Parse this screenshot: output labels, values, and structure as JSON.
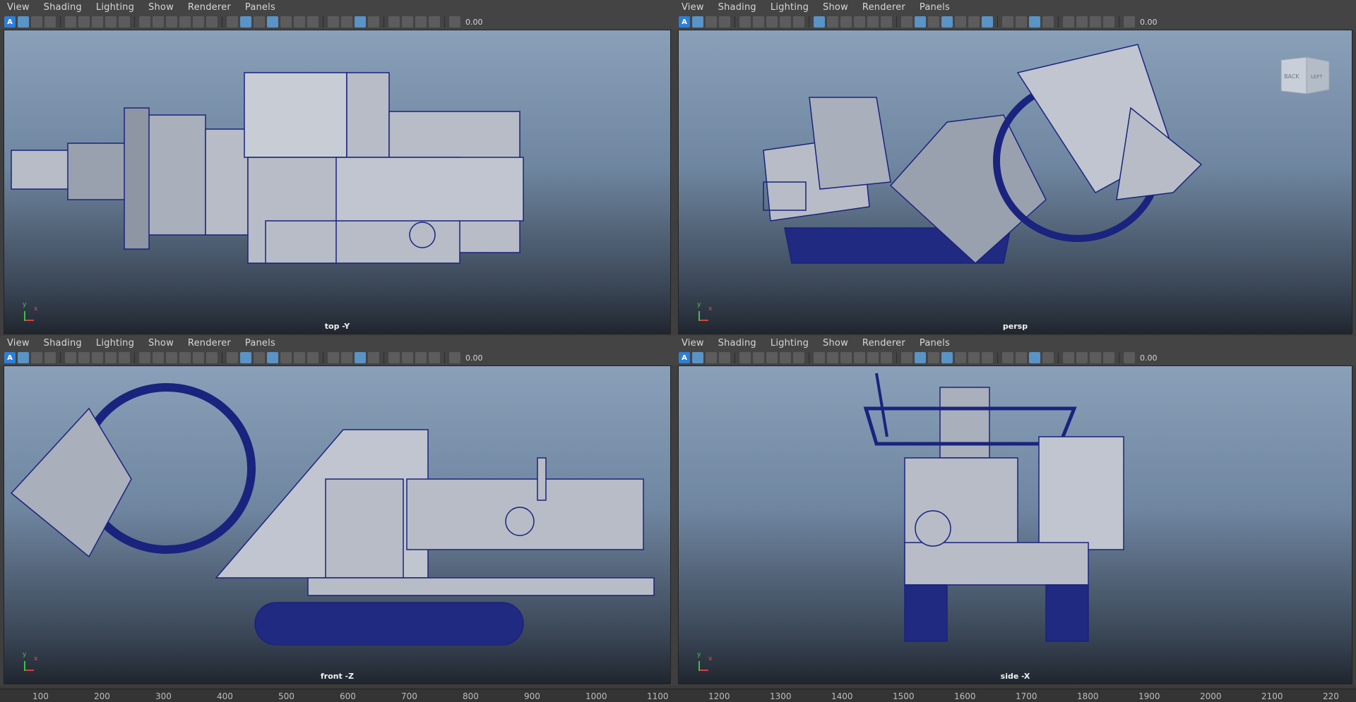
{
  "menu": [
    "View",
    "Shading",
    "Lighting",
    "Show",
    "Renderer",
    "Panels"
  ],
  "toolbar": {
    "value": "0.00",
    "a_label": "A"
  },
  "viewports": {
    "top_left": {
      "camera": "top -Y"
    },
    "top_right": {
      "camera": "persp",
      "viewcube": {
        "face1": "BACK",
        "face2": "LEFT"
      }
    },
    "bottom_left": {
      "camera": "front -Z"
    },
    "bottom_right": {
      "camera": "side -X"
    }
  },
  "axis_labels": {
    "x": "x",
    "y": "y"
  },
  "ruler": {
    "ticks": [
      "100",
      "200",
      "300",
      "400",
      "500",
      "600",
      "700",
      "800",
      "900",
      "1000",
      "1100",
      "1200",
      "1300",
      "1400",
      "1500",
      "1600",
      "1700",
      "1800",
      "1900",
      "2000",
      "2100",
      "220"
    ]
  },
  "colors": {
    "wire": "#1a237e",
    "surface": "#b7bcc7",
    "viewport_top": "#8aa0b9",
    "viewport_bottom": "#20262f",
    "accent": "#5a93c5"
  }
}
